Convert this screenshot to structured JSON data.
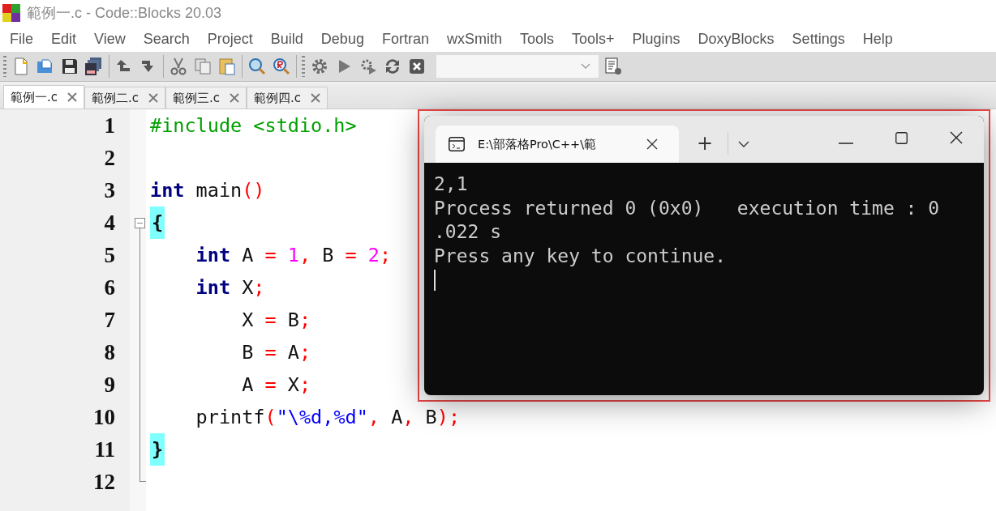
{
  "window": {
    "title": "範例一.c - Code::Blocks 20.03"
  },
  "menu": [
    "File",
    "Edit",
    "View",
    "Search",
    "Project",
    "Build",
    "Debug",
    "Fortran",
    "wxSmith",
    "Tools",
    "Tools+",
    "Plugins",
    "DoxyBlocks",
    "Settings",
    "Help"
  ],
  "tabs": [
    {
      "label": "範例一.c",
      "selected": true
    },
    {
      "label": "範例二.c",
      "selected": false
    },
    {
      "label": "範例三.c",
      "selected": false
    },
    {
      "label": "範例四.c",
      "selected": false
    }
  ],
  "editor": {
    "lines": [
      {
        "number": "1",
        "kind": "plain",
        "tokens": [
          {
            "kind": "preproc",
            "text": "#include <stdio.h>"
          }
        ]
      },
      {
        "number": "2",
        "kind": "plain"
      },
      {
        "number": "3",
        "kind": "plain",
        "tokens": [
          {
            "kind": "keyword",
            "text": "int"
          },
          {
            "kind": "plain",
            "text": " main"
          },
          {
            "kind": "operator",
            "text": "()"
          }
        ]
      },
      {
        "number": "4",
        "kind": "foldstart",
        "tokens": [
          {
            "kind": "brace",
            "text": "{"
          }
        ]
      },
      {
        "number": "5",
        "kind": "foldbody",
        "tokens": [
          {
            "kind": "keyword",
            "text": "    int"
          },
          {
            "kind": "plain",
            "text": " A "
          },
          {
            "kind": "operator",
            "text": "="
          },
          {
            "kind": "number",
            "text": " 1"
          },
          {
            "kind": "operator",
            "text": ","
          },
          {
            "kind": "plain",
            "text": " B "
          },
          {
            "kind": "operator",
            "text": "="
          },
          {
            "kind": "number",
            "text": " 2"
          },
          {
            "kind": "operator",
            "text": ";"
          }
        ]
      },
      {
        "number": "6",
        "kind": "foldbody",
        "tokens": [
          {
            "kind": "keyword",
            "text": "    int"
          },
          {
            "kind": "plain",
            "text": " X"
          },
          {
            "kind": "operator",
            "text": ";"
          }
        ]
      },
      {
        "number": "7",
        "kind": "foldbody",
        "tokens": [
          {
            "kind": "plain",
            "text": "        X "
          },
          {
            "kind": "operator",
            "text": "="
          },
          {
            "kind": "plain",
            "text": " B"
          },
          {
            "kind": "operator",
            "text": ";"
          }
        ]
      },
      {
        "number": "8",
        "kind": "foldbody",
        "tokens": [
          {
            "kind": "plain",
            "text": "        B "
          },
          {
            "kind": "operator",
            "text": "="
          },
          {
            "kind": "plain",
            "text": " A"
          },
          {
            "kind": "operator",
            "text": ";"
          }
        ]
      },
      {
        "number": "9",
        "kind": "foldbody",
        "tokens": [
          {
            "kind": "plain",
            "text": "        A "
          },
          {
            "kind": "operator",
            "text": "="
          },
          {
            "kind": "plain",
            "text": " X"
          },
          {
            "kind": "operator",
            "text": ";"
          }
        ]
      },
      {
        "number": "10",
        "kind": "foldbody",
        "tokens": [
          {
            "kind": "plain",
            "text": "    printf"
          },
          {
            "kind": "operator",
            "text": "("
          },
          {
            "kind": "string",
            "text": "\"\\%d,%d\""
          },
          {
            "kind": "operator",
            "text": ","
          },
          {
            "kind": "plain",
            "text": " A"
          },
          {
            "kind": "operator",
            "text": ","
          },
          {
            "kind": "plain",
            "text": " B"
          },
          {
            "kind": "operator",
            "text": ");"
          }
        ]
      },
      {
        "number": "11",
        "kind": "foldbody",
        "tokens": [
          {
            "kind": "brace",
            "text": "}"
          }
        ]
      },
      {
        "number": "12",
        "kind": "foldend"
      }
    ]
  },
  "terminal": {
    "tab_title": "E:\\部落格Pro\\C++\\範",
    "new_tab": "+",
    "output": [
      "2,1",
      "Process returned 0 (0x0)   execution time : 0",
      ".022 s",
      "Press any key to continue."
    ]
  }
}
